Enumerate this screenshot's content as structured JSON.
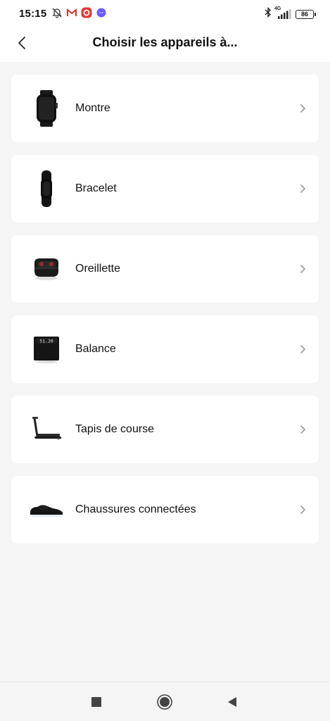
{
  "status_bar": {
    "time": "15:15",
    "network_label": "4G",
    "battery": "86",
    "left_icons": [
      "mute-bell-icon",
      "gmail-icon",
      "app-notification-icon",
      "messenger-icon"
    ],
    "right_icons": [
      "bluetooth-icon",
      "signal-icon",
      "battery-icon"
    ]
  },
  "header": {
    "title": "Choisir les appareils à..."
  },
  "devices": [
    {
      "label": "Montre",
      "icon": "watch-image"
    },
    {
      "label": "Bracelet",
      "icon": "band-image"
    },
    {
      "label": "Oreillette",
      "icon": "earbuds-image"
    },
    {
      "label": "Balance",
      "icon": "scale-image"
    },
    {
      "label": "Tapis de course",
      "icon": "treadmill-image"
    },
    {
      "label": "Chaussures connectées",
      "icon": "shoe-image"
    }
  ],
  "scale_display": "51.20",
  "nav": {
    "buttons": [
      "recents-button",
      "home-button",
      "back-nav-button"
    ]
  },
  "colors": {
    "background": "#f5f5f5",
    "card": "#ffffff",
    "text": "#111111",
    "chevron": "#9a9a9a",
    "gmail_red": "#d93025",
    "app_red": "#e53935",
    "messenger_blue": "#6a5cff"
  }
}
